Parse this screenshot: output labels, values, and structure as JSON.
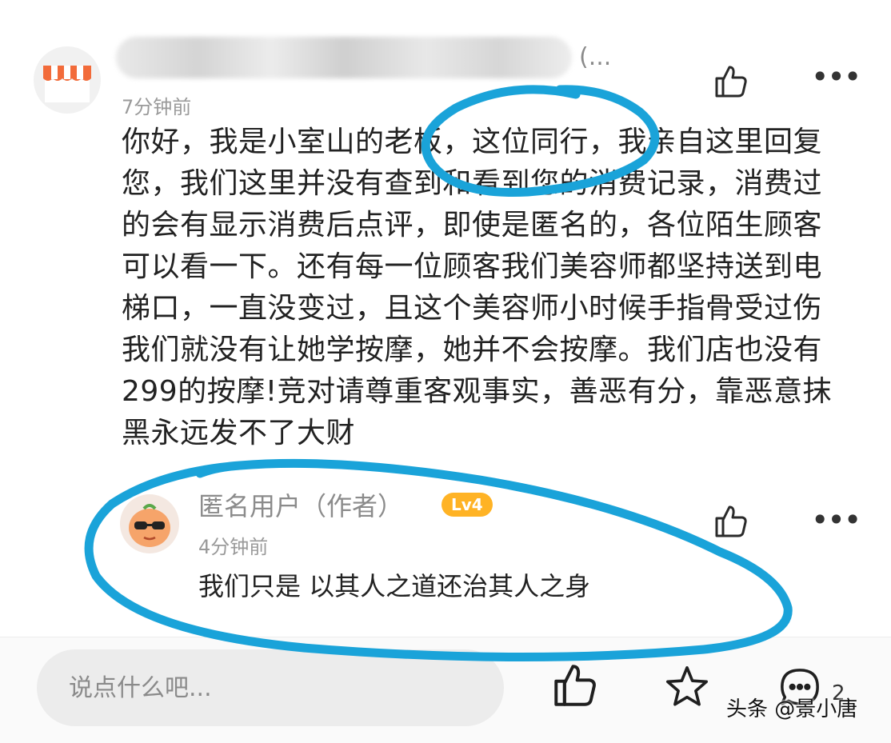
{
  "comment": {
    "author_suffix": "(...",
    "time": "7分钟前",
    "body": "你好，我是小室山的老板，这位同行，我亲自这里回复\n您，我们这里并没有查到和看到您的消费记录，消费过\n的会有显示消费后点评，即使是匿名的，各位陌生顾客\n可以看一下。还有每一位顾客我们美容师都坚持送到电\n梯口，一直没变过，且这个美容师小时候手指骨受过伤\n我们就没有让她学按摩，她并不会按摩。我们店也没有\n299的按摩!竞对请尊重客观事实，善恶有分，靠恶意抹\n黑永远发不了大财"
  },
  "reply": {
    "author": "匿名用户（作者）",
    "level": "Lv4",
    "time": "4分钟前",
    "body": "我们只是 以其人之道还治其人之身"
  },
  "bottom_bar": {
    "input_placeholder": "说点什么吧...",
    "comment_count": "2"
  },
  "watermark": "头条 @景小唐",
  "colors": {
    "annotation": "#1aa3d9",
    "badge": "#ffb325",
    "shop_awning": "#f26b3a"
  }
}
